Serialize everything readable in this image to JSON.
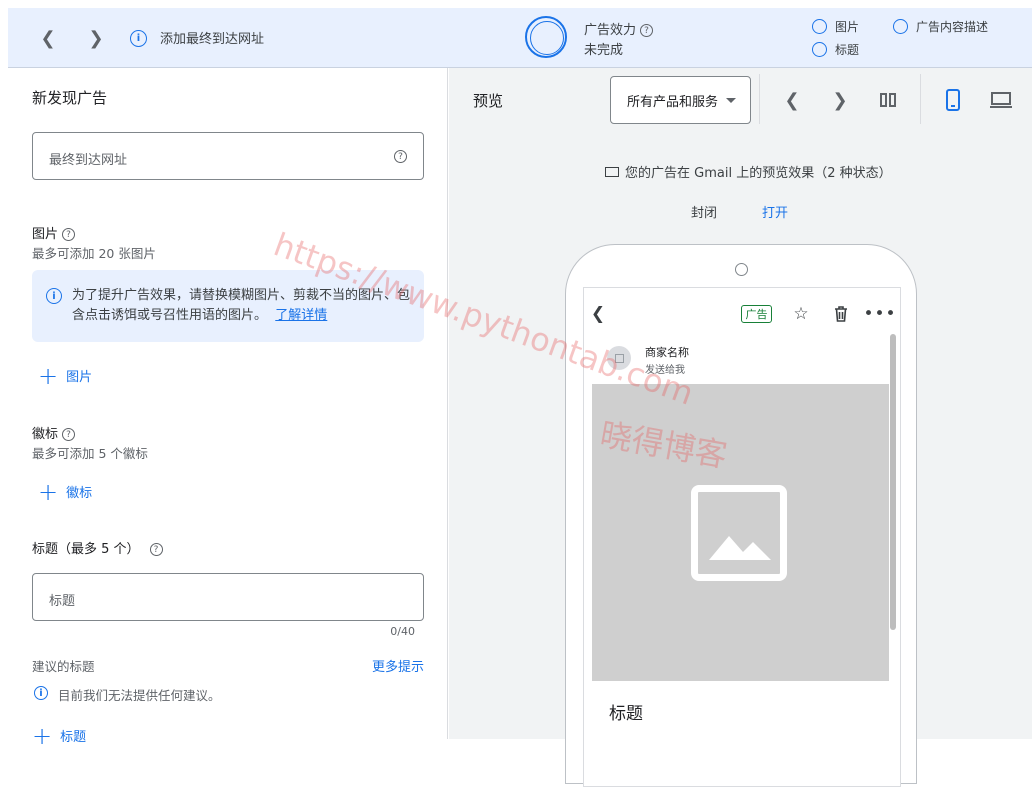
{
  "topbar": {
    "back_icon": "chevron-left-icon",
    "forward_icon": "chevron-right-icon",
    "url_notice": "添加最终到达网址",
    "effectiveness_title": "广告效力",
    "effectiveness_status": "未完成",
    "checklist": [
      "图片",
      "标题",
      "广告内容描述"
    ]
  },
  "editor": {
    "title": "新发现广告",
    "final_url_placeholder": "最终到达网址",
    "images": {
      "label": "图片",
      "hint": "最多可添加 20 张图片",
      "notice": "为了提升广告效果，请替换模糊图片、剪裁不当的图片、包含点击诱饵或号召性用语的图片。",
      "notice_link": "了解详情",
      "add_label": "图片"
    },
    "logos": {
      "label": "徽标",
      "hint": "最多可添加 5 个徽标",
      "add_label": "徽标"
    },
    "headlines": {
      "label": "标题（最多 5 个）",
      "placeholder": "标题",
      "counter": "0/40",
      "suggested_label": "建议的标题",
      "more_tips": "更多提示",
      "no_suggestions": "目前我们无法提供任何建议。",
      "add_label": "标题"
    }
  },
  "preview": {
    "title": "预览",
    "dropdown_value": "所有产品和服务",
    "caption": "您的广告在 Gmail 上的预览效果（2 种状态）",
    "tab_closed": "封闭",
    "tab_open": "打开",
    "ad_badge": "广告",
    "merchant_name": "商家名称",
    "sent_to": "发送给我",
    "headline": "标题"
  },
  "watermark": {
    "url": "https://www.pythontab.com",
    "name": "晓得博客"
  },
  "colors": {
    "accent": "#1a73e8",
    "topbar_bg": "#e8f0fe",
    "preview_bg": "#f1f3f4",
    "ad_badge": "#188038"
  }
}
